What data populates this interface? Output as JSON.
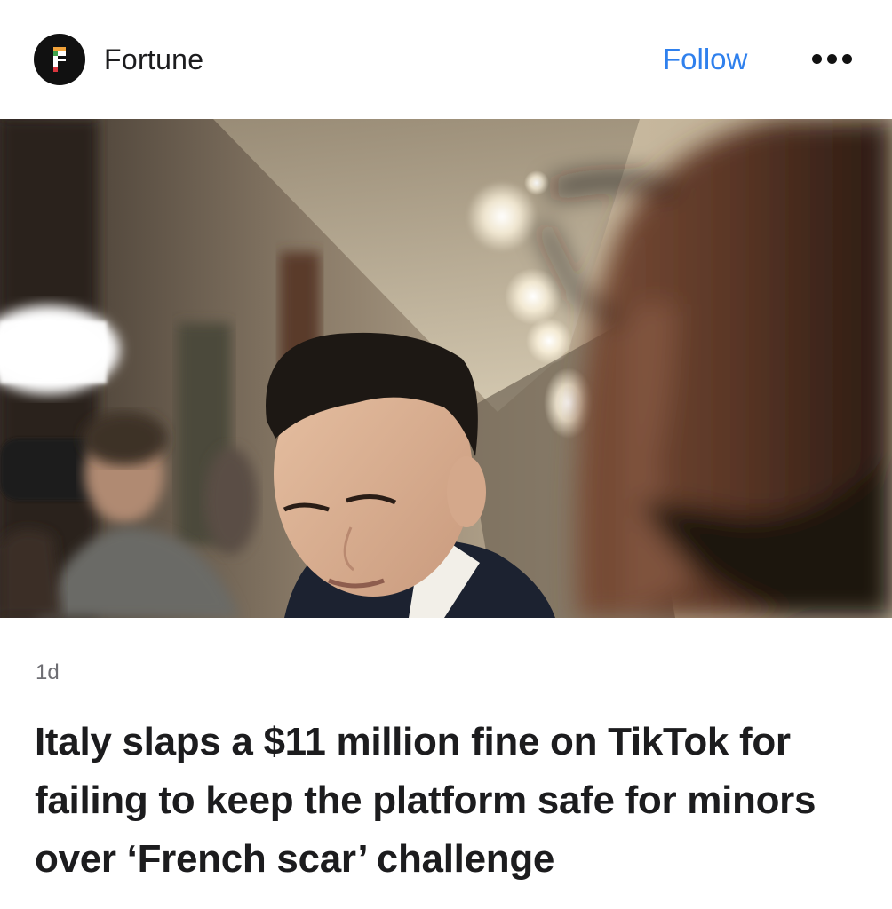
{
  "header": {
    "publisher": "Fortune",
    "follow_label": "Follow",
    "more_icon": "more-horizontal-icon",
    "logo_icon": "fortune-logo-icon"
  },
  "article": {
    "image_alt": "TikTok CEO walking in a hallway past reporters",
    "time_ago": "1d",
    "headline": "Italy slaps a $11 million fine on TikTok for failing to keep the platform safe for minors over ‘French scar’ challenge"
  },
  "colors": {
    "accent": "#2f80ed",
    "text": "#1c1c1e",
    "muted": "#6e6e73"
  }
}
